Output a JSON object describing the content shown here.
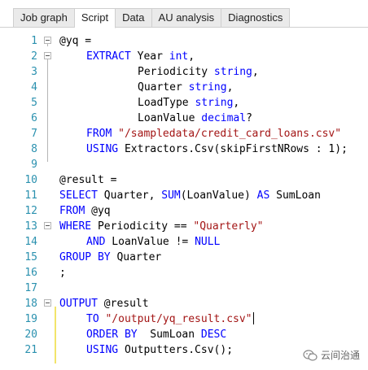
{
  "tabs": [
    {
      "label": "Job graph",
      "active": false
    },
    {
      "label": "Script",
      "active": true
    },
    {
      "label": "Data",
      "active": false
    },
    {
      "label": "AU analysis",
      "active": false
    },
    {
      "label": "Diagnostics",
      "active": false
    }
  ],
  "line_numbers": [
    "1",
    "2",
    "3",
    "4",
    "5",
    "6",
    "7",
    "8",
    "9",
    "10",
    "11",
    "12",
    "13",
    "14",
    "15",
    "16",
    "17",
    "18",
    "19",
    "20",
    "21"
  ],
  "code": {
    "l1": {
      "a": "@yq ="
    },
    "l2": {
      "kw": "EXTRACT",
      "a": " Year ",
      "t": "int",
      "b": ","
    },
    "l3": {
      "a": "Periodicity ",
      "t": "string",
      "b": ","
    },
    "l4": {
      "a": "Quarter ",
      "t": "string",
      "b": ","
    },
    "l5": {
      "a": "LoadType ",
      "t": "string",
      "b": ","
    },
    "l6": {
      "a": "LoanValue ",
      "t": "decimal",
      "b": "?"
    },
    "l7": {
      "kw": "FROM",
      "s": "\"/sampledata/credit_card_loans.csv\""
    },
    "l8": {
      "kw": "USING",
      "a": " Extractors.Csv(skipFirstNRows : ",
      "n": "1",
      "b": ");"
    },
    "l10": {
      "a": "@result ="
    },
    "l11": {
      "kw": "SELECT",
      "a": " Quarter, ",
      "kw2": "SUM",
      "b": "(LoanValue) ",
      "kw3": "AS",
      "c": " SumLoan"
    },
    "l12": {
      "kw": "FROM",
      "a": " @yq"
    },
    "l13": {
      "kw": "WHERE",
      "a": " Periodicity == ",
      "s": "\"Quarterly\""
    },
    "l14": {
      "kw": "AND",
      "a": " LoanValue != ",
      "kw2": "NULL"
    },
    "l15": {
      "kw": "GROUP BY",
      "a": " Quarter"
    },
    "l16": {
      "a": ";"
    },
    "l18": {
      "kw": "OUTPUT",
      "a": " @result"
    },
    "l19": {
      "kw": "TO",
      "s": " \"/output/yq_result.csv\""
    },
    "l20": {
      "kw": "ORDER BY",
      "a": "  SumLoan ",
      "kw2": "DESC"
    },
    "l21": {
      "kw": "USING",
      "a": " Outputters.Csv();"
    }
  },
  "watermark": {
    "text": "云间治通",
    "icon": "wechat-icon"
  }
}
